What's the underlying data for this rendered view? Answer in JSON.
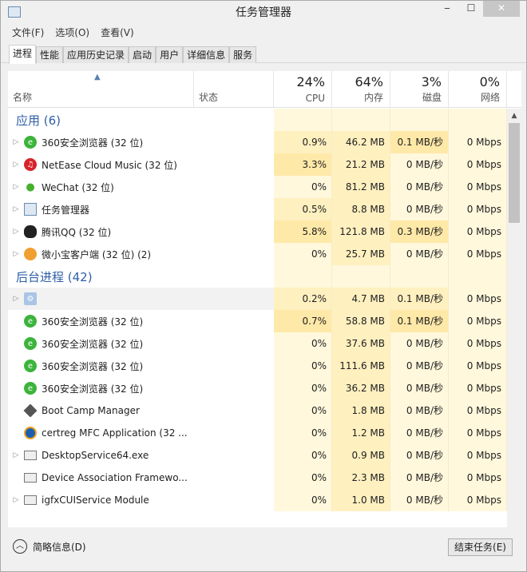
{
  "window": {
    "title": "任务管理器",
    "min": "‒",
    "max": "☐",
    "close": "✕"
  },
  "menu": [
    "文件(F)",
    "选项(O)",
    "查看(V)"
  ],
  "tabs": [
    "进程",
    "性能",
    "应用历史记录",
    "启动",
    "用户",
    "详细信息",
    "服务"
  ],
  "columns": {
    "name": "名称",
    "status": "状态",
    "cpu": {
      "pct": "24%",
      "label": "CPU"
    },
    "mem": {
      "pct": "64%",
      "label": "内存"
    },
    "disk": {
      "pct": "3%",
      "label": "磁盘"
    },
    "net": {
      "pct": "0%",
      "label": "网络"
    }
  },
  "groups": [
    {
      "title": "应用 (6)",
      "rows": [
        {
          "name": "360安全浏览器 (32 位)",
          "icon": "e360",
          "exp": true,
          "cpu": "0.9%",
          "mem": "46.2 MB",
          "disk": "0.1 MB/秒",
          "net": "0 Mbps",
          "heat": [
            1,
            1,
            2,
            0
          ]
        },
        {
          "name": "NetEase Cloud Music (32 位)",
          "icon": "netease",
          "exp": true,
          "cpu": "3.3%",
          "mem": "21.2 MB",
          "disk": "0 MB/秒",
          "net": "0 Mbps",
          "heat": [
            2,
            1,
            0,
            0
          ]
        },
        {
          "name": "WeChat (32 位)",
          "icon": "wechat",
          "exp": true,
          "cpu": "0%",
          "mem": "81.2 MB",
          "disk": "0 MB/秒",
          "net": "0 Mbps",
          "heat": [
            0,
            1,
            0,
            0
          ]
        },
        {
          "name": "任务管理器",
          "icon": "tm",
          "exp": true,
          "cpu": "0.5%",
          "mem": "8.8 MB",
          "disk": "0 MB/秒",
          "net": "0 Mbps",
          "heat": [
            1,
            1,
            0,
            0
          ]
        },
        {
          "name": "腾讯QQ (32 位)",
          "icon": "qq",
          "exp": true,
          "cpu": "5.8%",
          "mem": "121.8 MB",
          "disk": "0.3 MB/秒",
          "net": "0 Mbps",
          "heat": [
            2,
            1,
            2,
            0
          ]
        },
        {
          "name": "微小宝客户端 (32 位) (2)",
          "icon": "bao",
          "exp": true,
          "cpu": "0%",
          "mem": "25.7 MB",
          "disk": "0 MB/秒",
          "net": "0 Mbps",
          "heat": [
            0,
            1,
            0,
            0
          ]
        }
      ]
    },
    {
      "title": "后台进程 (42)",
      "rows": [
        {
          "name": "",
          "icon": "gear",
          "exp": true,
          "sel": true,
          "cpu": "0.2%",
          "mem": "4.7 MB",
          "disk": "0.1 MB/秒",
          "net": "0 Mbps",
          "heat": [
            1,
            1,
            1,
            0
          ]
        },
        {
          "name": "360安全浏览器 (32 位)",
          "icon": "e360",
          "exp": false,
          "cpu": "0.7%",
          "mem": "58.8 MB",
          "disk": "0.1 MB/秒",
          "net": "0 Mbps",
          "heat": [
            2,
            1,
            2,
            0
          ]
        },
        {
          "name": "360安全浏览器 (32 位)",
          "icon": "e360",
          "exp": false,
          "cpu": "0%",
          "mem": "37.6 MB",
          "disk": "0 MB/秒",
          "net": "0 Mbps",
          "heat": [
            0,
            1,
            0,
            0
          ]
        },
        {
          "name": "360安全浏览器 (32 位)",
          "icon": "e360",
          "exp": false,
          "cpu": "0%",
          "mem": "111.6 MB",
          "disk": "0 MB/秒",
          "net": "0 Mbps",
          "heat": [
            0,
            1,
            0,
            0
          ]
        },
        {
          "name": "360安全浏览器 (32 位)",
          "icon": "e360",
          "exp": false,
          "cpu": "0%",
          "mem": "36.2 MB",
          "disk": "0 MB/秒",
          "net": "0 Mbps",
          "heat": [
            0,
            1,
            0,
            0
          ]
        },
        {
          "name": "Boot Camp Manager",
          "icon": "diamond",
          "exp": false,
          "cpu": "0%",
          "mem": "1.8 MB",
          "disk": "0 MB/秒",
          "net": "0 Mbps",
          "heat": [
            0,
            1,
            0,
            0
          ]
        },
        {
          "name": "certreg MFC Application (32 ...",
          "icon": "cert",
          "exp": false,
          "cpu": "0%",
          "mem": "1.2 MB",
          "disk": "0 MB/秒",
          "net": "0 Mbps",
          "heat": [
            0,
            1,
            0,
            0
          ]
        },
        {
          "name": "DesktopService64.exe",
          "icon": "svc",
          "exp": true,
          "cpu": "0%",
          "mem": "0.9 MB",
          "disk": "0 MB/秒",
          "net": "0 Mbps",
          "heat": [
            0,
            1,
            0,
            0
          ]
        },
        {
          "name": "Device Association Framewo...",
          "icon": "svc",
          "exp": false,
          "cpu": "0%",
          "mem": "2.3 MB",
          "disk": "0 MB/秒",
          "net": "0 Mbps",
          "heat": [
            0,
            1,
            0,
            0
          ]
        },
        {
          "name": "igfxCUIService Module",
          "icon": "svc",
          "exp": true,
          "cpu": "0%",
          "mem": "1.0 MB",
          "disk": "0 MB/秒",
          "net": "0 Mbps",
          "heat": [
            0,
            1,
            0,
            0
          ]
        }
      ]
    }
  ],
  "footer": {
    "less": "简略信息(D)",
    "end_task": "结束任务(E)"
  }
}
